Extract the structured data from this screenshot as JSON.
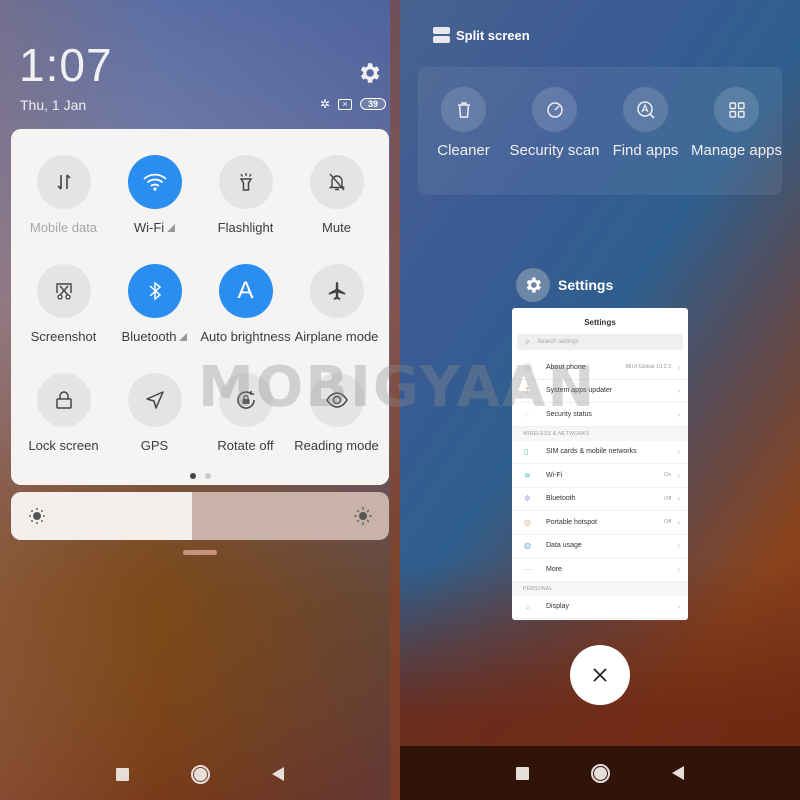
{
  "left": {
    "clock": "1:07",
    "date": "Thu, 1 Jan",
    "settings_icon": "gear-icon",
    "status": {
      "bluetooth_icon": "bluetooth-icon",
      "sim_icon": "no-sim-icon",
      "battery": "39"
    },
    "quick_settings": [
      {
        "label": "Mobile data",
        "icon": "mobile-data-icon",
        "active": false,
        "dimmed": true,
        "has_more": false
      },
      {
        "label": "Wi-Fi",
        "icon": "wifi-icon",
        "active": true,
        "dimmed": false,
        "has_more": true
      },
      {
        "label": "Flashlight",
        "icon": "flashlight-icon",
        "active": false,
        "dimmed": false,
        "has_more": false
      },
      {
        "label": "Mute",
        "icon": "mute-icon",
        "active": false,
        "dimmed": false,
        "has_more": false
      },
      {
        "label": "Screenshot",
        "icon": "screenshot-icon",
        "active": false,
        "dimmed": false,
        "has_more": false
      },
      {
        "label": "Bluetooth",
        "icon": "bluetooth-icon",
        "active": true,
        "dimmed": false,
        "has_more": true
      },
      {
        "label": "Auto brightness",
        "icon": "auto-brightness-icon",
        "active": true,
        "dimmed": false,
        "has_more": false
      },
      {
        "label": "Airplane mode",
        "icon": "airplane-icon",
        "active": false,
        "dimmed": false,
        "has_more": false
      },
      {
        "label": "Lock screen",
        "icon": "lock-icon",
        "active": false,
        "dimmed": false,
        "has_more": false
      },
      {
        "label": "GPS",
        "icon": "gps-icon",
        "active": false,
        "dimmed": false,
        "has_more": false
      },
      {
        "label": "Rotate off",
        "icon": "rotate-lock-icon",
        "active": false,
        "dimmed": false,
        "has_more": false
      },
      {
        "label": "Reading mode",
        "icon": "eye-icon",
        "active": false,
        "dimmed": false,
        "has_more": false
      }
    ],
    "page_dots": {
      "count": 2,
      "active": 0
    },
    "brightness_percent": 48
  },
  "right": {
    "split_screen_label": "Split screen",
    "tools": [
      {
        "label": "Cleaner",
        "icon": "trash-icon"
      },
      {
        "label": "Security scan",
        "icon": "security-scan-icon"
      },
      {
        "label": "Find apps",
        "icon": "find-apps-icon"
      },
      {
        "label": "Manage apps",
        "icon": "grid-icon"
      }
    ],
    "recent_app": {
      "title": "Settings",
      "card_title": "Settings",
      "search_placeholder": "Search settings",
      "rows_top": [
        {
          "label": "About phone",
          "value": "MIUI Global 10.2.3",
          "icon": "info-icon"
        },
        {
          "label": "System apps updater",
          "value": "",
          "icon": "update-icon"
        },
        {
          "label": "Security status",
          "value": "",
          "icon": "shield-icon"
        }
      ],
      "section_wireless": "WIRELESS & NETWORKS",
      "rows_wireless": [
        {
          "label": "SIM cards & mobile networks",
          "value": "",
          "icon": "sim-icon"
        },
        {
          "label": "Wi-Fi",
          "value": "On",
          "icon": "wifi-icon"
        },
        {
          "label": "Bluetooth",
          "value": "Off",
          "icon": "bluetooth-icon"
        },
        {
          "label": "Portable hotspot",
          "value": "Off",
          "icon": "hotspot-icon"
        },
        {
          "label": "Data usage",
          "value": "",
          "icon": "data-usage-icon"
        },
        {
          "label": "More",
          "value": "",
          "icon": "more-icon"
        }
      ],
      "section_personal": "PERSONAL",
      "rows_personal": [
        {
          "label": "Display",
          "value": "",
          "icon": "display-icon"
        }
      ]
    },
    "close_icon": "close-icon"
  },
  "nav": {
    "recents": "recents-icon",
    "home": "home-icon",
    "back": "back-icon"
  },
  "watermark": "MOBIGYAAN"
}
